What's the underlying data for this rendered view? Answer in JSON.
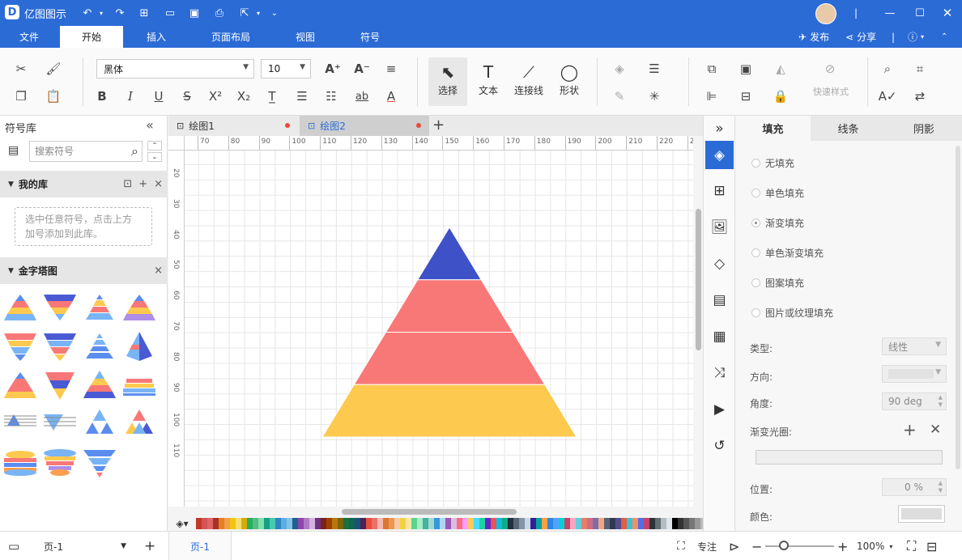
{
  "app": {
    "title": "亿图图示",
    "logo": "D"
  },
  "quick_access": [
    "undo-icon",
    "redo-icon",
    "new-icon",
    "open-icon",
    "save-icon",
    "print-icon",
    "export-icon",
    "more-icon"
  ],
  "menu": {
    "tabs": [
      {
        "label": "文件"
      },
      {
        "label": "开始"
      },
      {
        "label": "插入"
      },
      {
        "label": "页面布局"
      },
      {
        "label": "视图"
      },
      {
        "label": "符号"
      }
    ],
    "active": "开始",
    "publish": "发布",
    "share": "分享"
  },
  "ribbon": {
    "font": "黑体",
    "font_size": "10",
    "tools": {
      "select": "选择",
      "text": "文本",
      "connector": "连接线",
      "shape": "形状",
      "quick_style": "快速样式"
    }
  },
  "left_panel": {
    "title": "符号库",
    "search_placeholder": "搜索符号",
    "my_library": {
      "title": "我的库",
      "hint_line1": "选中任意符号，点击上方",
      "hint_line2": "加号添加到此库。"
    },
    "pyramid_section": {
      "title": "金字塔图"
    }
  },
  "doc_tabs": [
    {
      "label": "绘图1",
      "active": false
    },
    {
      "label": "绘图2",
      "active": true
    }
  ],
  "ruler": {
    "top": [
      "70",
      "80",
      "90",
      "100",
      "110",
      "120",
      "130",
      "140",
      "150",
      "160",
      "170",
      "180",
      "190",
      "200",
      "210",
      "220",
      "2"
    ],
    "left": [
      "20",
      "30",
      "40",
      "50",
      "60",
      "70",
      "80",
      "90",
      "100",
      "110"
    ]
  },
  "pyramid": {
    "layers": [
      {
        "color": "#3f51c6"
      },
      {
        "color": "#f87878"
      },
      {
        "color": "#f87878"
      },
      {
        "color": "#fdc94e"
      }
    ]
  },
  "properties": {
    "tabs": {
      "fill": "填充",
      "line": "线条",
      "shadow": "阴影"
    },
    "fill_options": [
      {
        "label": "无填充",
        "selected": false
      },
      {
        "label": "单色填充",
        "selected": false
      },
      {
        "label": "渐变填充",
        "selected": true
      },
      {
        "label": "单色渐变填充",
        "selected": false
      },
      {
        "label": "图案填充",
        "selected": false
      },
      {
        "label": "图片或纹理填充",
        "selected": false
      }
    ],
    "type_label": "类型:",
    "type_value": "线性",
    "direction_label": "方向:",
    "angle_label": "角度:",
    "angle_value": "90 deg",
    "stops_label": "渐变光圈:",
    "position_label": "位置:",
    "position_value": "0 %",
    "color_label": "颜色:"
  },
  "status": {
    "page_select": "页-1",
    "page_tab": "页-1",
    "focus": "专注",
    "zoom": "100%"
  },
  "palette": [
    "#c0392b",
    "#d35454",
    "#e06666",
    "#a93226",
    "#e67e22",
    "#f0a04b",
    "#f1c40f",
    "#f7dc6f",
    "#d4ac0d",
    "#27ae60",
    "#52be80",
    "#82e0aa",
    "#16a085",
    "#48c9b0",
    "#2e86c1",
    "#5dade2",
    "#85c1e9",
    "#1f618d",
    "#8e44ad",
    "#af7ac5",
    "#d2b4de",
    "#6c3483",
    "#7b241c",
    "#a04000",
    "#b9770e",
    "#7d6608",
    "#196f3d",
    "#0e6655",
    "#1a5276",
    "#4a235a",
    "#e74c3c",
    "#ec7063",
    "#f5b7b1",
    "#dc7633",
    "#eb984e",
    "#f5cba7",
    "#f4d03f",
    "#f9e79f",
    "#58d68d",
    "#abebc6",
    "#45b39d",
    "#a2d9ce",
    "#3498db",
    "#aed6f1",
    "#9b59b6",
    "#d7bde2",
    "#ff6b81",
    "#ff9ff3",
    "#feca57",
    "#48dbfb",
    "#1dd1a1",
    "#5f27cd",
    "#ee5253",
    "#0abde3",
    "#10ac84",
    "#222f3e",
    "#576574",
    "#8395a7",
    "#c8d6e5",
    "#341f97",
    "#01a3a4",
    "#ff9f43",
    "#2e86de",
    "#54a0ff",
    "#00d2d3",
    "#c44569",
    "#f8a5c2",
    "#63cdda",
    "#e77f67",
    "#cf6a87",
    "#786fa6",
    "#f3a683",
    "#596275",
    "#303952",
    "#574b90",
    "#e15f41",
    "#3dc1d3",
    "#f19066",
    "#546de5",
    "#c44569",
    "#2d3436",
    "#636e72",
    "#b2bec3",
    "#dfe6e9",
    "#000000",
    "#333333",
    "#555555",
    "#777777",
    "#999999",
    "#bbbbbb",
    "#dddddd",
    "#ffffff"
  ]
}
